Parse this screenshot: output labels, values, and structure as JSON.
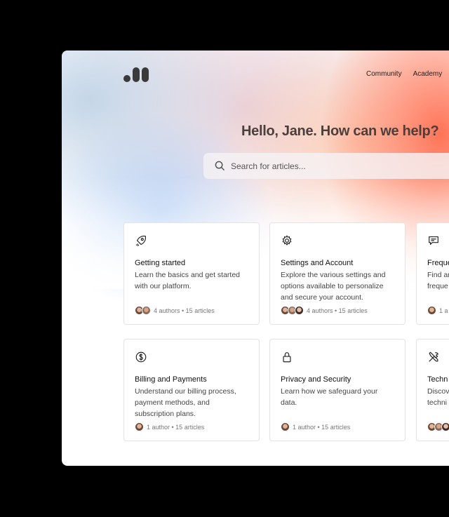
{
  "nav": {
    "items": [
      "Community",
      "Academy"
    ]
  },
  "hero": {
    "title": "Hello, Jane. How can we help?"
  },
  "search": {
    "placeholder": "Search for articles..."
  },
  "cards": [
    {
      "icon": "rocket-icon",
      "title": "Getting started",
      "desc": "Learn the basics and get started with our platform.",
      "meta": "4 authors • 15 articles"
    },
    {
      "icon": "gear-icon",
      "title": "Settings and Account",
      "desc": "Explore the various settings and options available to personalize and secure your account.",
      "meta": "4 authors • 15 articles"
    },
    {
      "icon": "chat-icon",
      "title": "Freque",
      "desc": "Find ar freque",
      "meta": "1 a"
    },
    {
      "icon": "dollar-icon",
      "title": "Billing and Payments",
      "desc": "Understand our billing process, payment methods, and subscription plans.",
      "meta": "1 author • 15 articles"
    },
    {
      "icon": "lock-icon",
      "title": "Privacy and Security",
      "desc": "Learn how we safeguard your data.",
      "meta": "1 author • 15 articles"
    },
    {
      "icon": "tools-icon",
      "title": "Techn",
      "desc": "Discov techni",
      "meta": ""
    }
  ]
}
